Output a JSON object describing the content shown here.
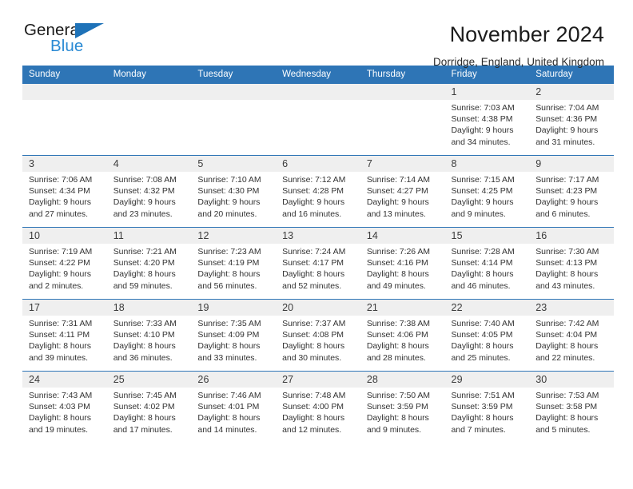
{
  "brand": {
    "name_part1": "General",
    "name_part2": "Blue",
    "triangle_color": "#1e72b8",
    "blue_text_color": "#2a8ad4"
  },
  "header": {
    "title": "November 2024",
    "subtitle": "Dorridge, England, United Kingdom",
    "accent_color": "#2e75b6",
    "daynum_band_color": "#efefef"
  },
  "weekday_headers": [
    "Sunday",
    "Monday",
    "Tuesday",
    "Wednesday",
    "Thursday",
    "Friday",
    "Saturday"
  ],
  "labels": {
    "sunrise_prefix": "Sunrise:",
    "sunset_prefix": "Sunset:",
    "daylight_prefix": "Daylight:"
  },
  "weeks": [
    [
      {
        "day": "",
        "empty": true
      },
      {
        "day": "",
        "empty": true
      },
      {
        "day": "",
        "empty": true
      },
      {
        "day": "",
        "empty": true
      },
      {
        "day": "",
        "empty": true
      },
      {
        "day": "1",
        "sunrise": "Sunrise: 7:03 AM",
        "sunset": "Sunset: 4:38 PM",
        "daylight": "Daylight: 9 hours and 34 minutes."
      },
      {
        "day": "2",
        "sunrise": "Sunrise: 7:04 AM",
        "sunset": "Sunset: 4:36 PM",
        "daylight": "Daylight: 9 hours and 31 minutes."
      }
    ],
    [
      {
        "day": "3",
        "sunrise": "Sunrise: 7:06 AM",
        "sunset": "Sunset: 4:34 PM",
        "daylight": "Daylight: 9 hours and 27 minutes."
      },
      {
        "day": "4",
        "sunrise": "Sunrise: 7:08 AM",
        "sunset": "Sunset: 4:32 PM",
        "daylight": "Daylight: 9 hours and 23 minutes."
      },
      {
        "day": "5",
        "sunrise": "Sunrise: 7:10 AM",
        "sunset": "Sunset: 4:30 PM",
        "daylight": "Daylight: 9 hours and 20 minutes."
      },
      {
        "day": "6",
        "sunrise": "Sunrise: 7:12 AM",
        "sunset": "Sunset: 4:28 PM",
        "daylight": "Daylight: 9 hours and 16 minutes."
      },
      {
        "day": "7",
        "sunrise": "Sunrise: 7:14 AM",
        "sunset": "Sunset: 4:27 PM",
        "daylight": "Daylight: 9 hours and 13 minutes."
      },
      {
        "day": "8",
        "sunrise": "Sunrise: 7:15 AM",
        "sunset": "Sunset: 4:25 PM",
        "daylight": "Daylight: 9 hours and 9 minutes."
      },
      {
        "day": "9",
        "sunrise": "Sunrise: 7:17 AM",
        "sunset": "Sunset: 4:23 PM",
        "daylight": "Daylight: 9 hours and 6 minutes."
      }
    ],
    [
      {
        "day": "10",
        "sunrise": "Sunrise: 7:19 AM",
        "sunset": "Sunset: 4:22 PM",
        "daylight": "Daylight: 9 hours and 2 minutes."
      },
      {
        "day": "11",
        "sunrise": "Sunrise: 7:21 AM",
        "sunset": "Sunset: 4:20 PM",
        "daylight": "Daylight: 8 hours and 59 minutes."
      },
      {
        "day": "12",
        "sunrise": "Sunrise: 7:23 AM",
        "sunset": "Sunset: 4:19 PM",
        "daylight": "Daylight: 8 hours and 56 minutes."
      },
      {
        "day": "13",
        "sunrise": "Sunrise: 7:24 AM",
        "sunset": "Sunset: 4:17 PM",
        "daylight": "Daylight: 8 hours and 52 minutes."
      },
      {
        "day": "14",
        "sunrise": "Sunrise: 7:26 AM",
        "sunset": "Sunset: 4:16 PM",
        "daylight": "Daylight: 8 hours and 49 minutes."
      },
      {
        "day": "15",
        "sunrise": "Sunrise: 7:28 AM",
        "sunset": "Sunset: 4:14 PM",
        "daylight": "Daylight: 8 hours and 46 minutes."
      },
      {
        "day": "16",
        "sunrise": "Sunrise: 7:30 AM",
        "sunset": "Sunset: 4:13 PM",
        "daylight": "Daylight: 8 hours and 43 minutes."
      }
    ],
    [
      {
        "day": "17",
        "sunrise": "Sunrise: 7:31 AM",
        "sunset": "Sunset: 4:11 PM",
        "daylight": "Daylight: 8 hours and 39 minutes."
      },
      {
        "day": "18",
        "sunrise": "Sunrise: 7:33 AM",
        "sunset": "Sunset: 4:10 PM",
        "daylight": "Daylight: 8 hours and 36 minutes."
      },
      {
        "day": "19",
        "sunrise": "Sunrise: 7:35 AM",
        "sunset": "Sunset: 4:09 PM",
        "daylight": "Daylight: 8 hours and 33 minutes."
      },
      {
        "day": "20",
        "sunrise": "Sunrise: 7:37 AM",
        "sunset": "Sunset: 4:08 PM",
        "daylight": "Daylight: 8 hours and 30 minutes."
      },
      {
        "day": "21",
        "sunrise": "Sunrise: 7:38 AM",
        "sunset": "Sunset: 4:06 PM",
        "daylight": "Daylight: 8 hours and 28 minutes."
      },
      {
        "day": "22",
        "sunrise": "Sunrise: 7:40 AM",
        "sunset": "Sunset: 4:05 PM",
        "daylight": "Daylight: 8 hours and 25 minutes."
      },
      {
        "day": "23",
        "sunrise": "Sunrise: 7:42 AM",
        "sunset": "Sunset: 4:04 PM",
        "daylight": "Daylight: 8 hours and 22 minutes."
      }
    ],
    [
      {
        "day": "24",
        "sunrise": "Sunrise: 7:43 AM",
        "sunset": "Sunset: 4:03 PM",
        "daylight": "Daylight: 8 hours and 19 minutes."
      },
      {
        "day": "25",
        "sunrise": "Sunrise: 7:45 AM",
        "sunset": "Sunset: 4:02 PM",
        "daylight": "Daylight: 8 hours and 17 minutes."
      },
      {
        "day": "26",
        "sunrise": "Sunrise: 7:46 AM",
        "sunset": "Sunset: 4:01 PM",
        "daylight": "Daylight: 8 hours and 14 minutes."
      },
      {
        "day": "27",
        "sunrise": "Sunrise: 7:48 AM",
        "sunset": "Sunset: 4:00 PM",
        "daylight": "Daylight: 8 hours and 12 minutes."
      },
      {
        "day": "28",
        "sunrise": "Sunrise: 7:50 AM",
        "sunset": "Sunset: 3:59 PM",
        "daylight": "Daylight: 8 hours and 9 minutes."
      },
      {
        "day": "29",
        "sunrise": "Sunrise: 7:51 AM",
        "sunset": "Sunset: 3:59 PM",
        "daylight": "Daylight: 8 hours and 7 minutes."
      },
      {
        "day": "30",
        "sunrise": "Sunrise: 7:53 AM",
        "sunset": "Sunset: 3:58 PM",
        "daylight": "Daylight: 8 hours and 5 minutes."
      }
    ]
  ]
}
